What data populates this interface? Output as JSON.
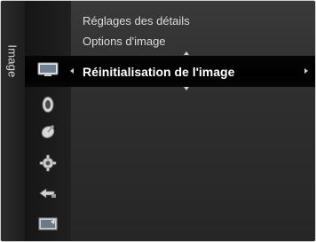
{
  "sidebar": {
    "label": "Image"
  },
  "menu": {
    "items": [
      {
        "label": "Réglages des détails"
      },
      {
        "label": "Options d'image"
      },
      {
        "label": "Réinitialisation de l'image",
        "selected": true
      }
    ]
  },
  "categories": [
    {
      "icon": "picture-icon",
      "active": true
    },
    {
      "icon": "sound-icon"
    },
    {
      "icon": "channel-icon"
    },
    {
      "icon": "setup-icon"
    },
    {
      "icon": "input-icon"
    },
    {
      "icon": "application-icon"
    }
  ],
  "colors": {
    "accent": "#ffffff",
    "text": "#dcdcdc",
    "panel": "#333333"
  }
}
